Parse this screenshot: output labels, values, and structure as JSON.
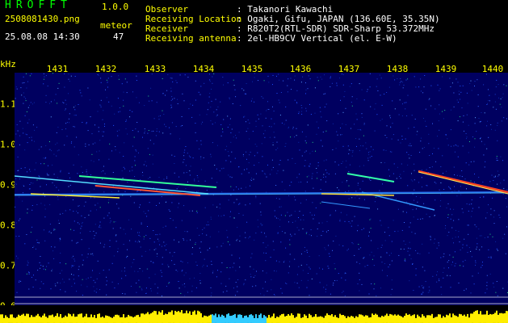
{
  "app": {
    "title": "HROFFT",
    "version": "1.0.0"
  },
  "file": {
    "name": "2508081430.png",
    "datetime": "25.08.08 14:30"
  },
  "meteor": {
    "label": "meteor",
    "count": "47"
  },
  "info": [
    {
      "key": "Observer",
      "value": ": Takanori Kawachi"
    },
    {
      "key": "Receiving Location",
      "value": ": Ogaki, Gifu, JAPAN (136.60E, 35.35N)"
    },
    {
      "key": "Receiver",
      "value": ": R820T2(RTL-SDR) SDR-Sharp 53.372MHz"
    },
    {
      "key": "Receiving antenna",
      "value": ": 2el-HB9CV Vertical (el. E-W)"
    }
  ],
  "axis": {
    "unit": "kHz",
    "time_ticks": [
      "1431",
      "1432",
      "1433",
      "1434",
      "1435",
      "1436",
      "1437",
      "1438",
      "1439",
      "1440"
    ],
    "freq_ticks": [
      "1.1",
      "1.0",
      "0.9",
      "0.8",
      "0.7",
      "0.6"
    ]
  },
  "colors": {
    "label": "#ffff00",
    "title": "#00ff00",
    "background": "#000060"
  }
}
